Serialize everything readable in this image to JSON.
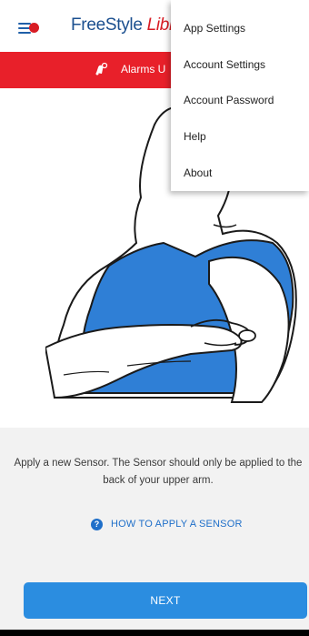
{
  "header": {
    "brand_prefix": "FreeStyle",
    "brand_suffix": "Libr",
    "menu_icon": "hamburger-menu-icon",
    "notification_badge_color": "#d81c24"
  },
  "alarm_banner": {
    "text": "Alarms U",
    "icon": "bell-alert-icon",
    "background": "#e8202a"
  },
  "illustration": {
    "description_icon": "arm-sensor-illustration"
  },
  "instructions": {
    "text": "Apply a new Sensor. The Sensor should only be applied to the back of your upper arm.",
    "howto_label": "HOW TO APPLY A SENSOR",
    "howto_icon": "question-circle-icon",
    "next_label": "NEXT",
    "accent": "#2b8de0"
  },
  "menu": {
    "items": [
      {
        "label": "App Settings"
      },
      {
        "label": "Account Settings"
      },
      {
        "label": "Account Password"
      },
      {
        "label": "Help"
      },
      {
        "label": "About"
      }
    ]
  }
}
